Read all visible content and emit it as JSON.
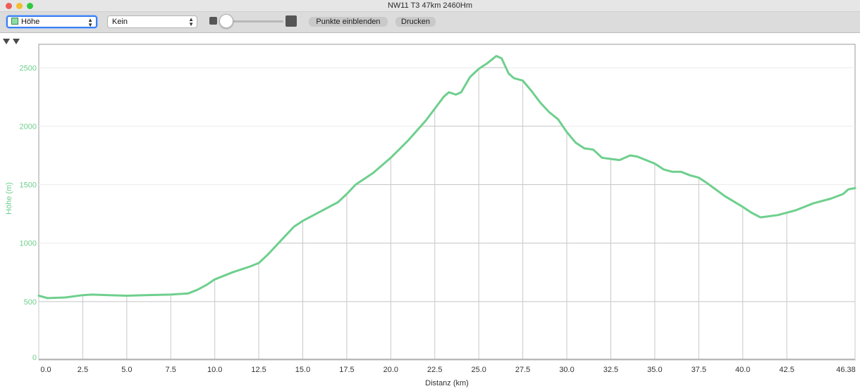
{
  "window": {
    "title": "NW11 T3 47km 2460Hm"
  },
  "toolbar": {
    "profile_select": "Höhe",
    "overlay_select": "Kein",
    "show_points_button": "Punkte einblenden",
    "print_button": "Drucken"
  },
  "colors": {
    "series": "#6ecf8d",
    "grid": "#c8c8c8",
    "grid_light": "#ececec"
  },
  "chart_data": {
    "type": "area",
    "xlabel": "Distanz (km)",
    "ylabel": "Höhe (m)",
    "xlim": [
      0,
      46.38
    ],
    "ylim": [
      0,
      2700
    ],
    "x_ticks": [
      0,
      2.5,
      5,
      7.5,
      10,
      12.5,
      15,
      17.5,
      20,
      22.5,
      25,
      27.5,
      30,
      32.5,
      35,
      37.5,
      40,
      42.5,
      46.38
    ],
    "x_tick_labels": [
      "0.0",
      "2.5",
      "5.0",
      "7.5",
      "10.0",
      "12.5",
      "15.0",
      "17.5",
      "20.0",
      "22.5",
      "25.0",
      "27.5",
      "30.0",
      "32.5",
      "35.0",
      "37.5",
      "40.0",
      "42.5",
      "46.38"
    ],
    "y_ticks": [
      0,
      500,
      1000,
      1500,
      2000,
      2500
    ],
    "y_tick_labels": [
      "0",
      "500",
      "1000",
      "1500",
      "2000",
      "2500"
    ],
    "grid": true,
    "series": [
      {
        "x": [
          0,
          0.5,
          1.5,
          2.5,
          3.0,
          4.0,
          5.0,
          6.0,
          7.5,
          8.5,
          9.0,
          9.5,
          10.0,
          11.0,
          12.0,
          12.5,
          13.0,
          14.0,
          14.5,
          15.0,
          16.0,
          17.0,
          17.5,
          18.0,
          19.0,
          20.0,
          21.0,
          22.0,
          22.5,
          23.0,
          23.3,
          23.7,
          24.0,
          24.5,
          25.0,
          25.5,
          26.0,
          26.3,
          26.7,
          27.0,
          27.5,
          28.0,
          28.5,
          29.0,
          29.5,
          30.0,
          30.5,
          31.0,
          31.5,
          32.0,
          32.5,
          33.0,
          33.6,
          34.0,
          35.0,
          35.5,
          36.0,
          36.5,
          37.0,
          37.5,
          38.0,
          39.0,
          40.0,
          40.5,
          41.0,
          42.0,
          43.0,
          44.0,
          45.0,
          45.7,
          46.0,
          46.38
        ],
        "y": [
          550,
          530,
          535,
          555,
          560,
          555,
          550,
          555,
          560,
          570,
          600,
          640,
          690,
          750,
          800,
          830,
          900,
          1060,
          1140,
          1190,
          1270,
          1350,
          1420,
          1500,
          1600,
          1730,
          1880,
          2050,
          2150,
          2250,
          2290,
          2270,
          2290,
          2420,
          2490,
          2540,
          2600,
          2580,
          2450,
          2410,
          2390,
          2300,
          2200,
          2120,
          2060,
          1950,
          1860,
          1810,
          1800,
          1730,
          1720,
          1710,
          1750,
          1740,
          1680,
          1630,
          1610,
          1610,
          1580,
          1560,
          1510,
          1400,
          1310,
          1260,
          1220,
          1240,
          1280,
          1340,
          1380,
          1420,
          1460,
          1470
        ]
      }
    ]
  }
}
